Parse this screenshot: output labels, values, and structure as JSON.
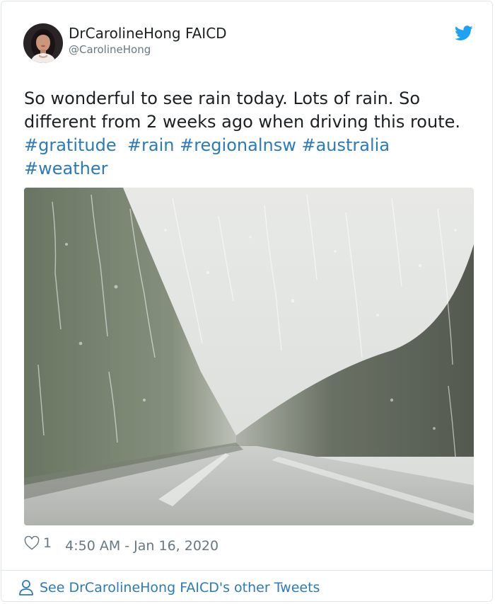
{
  "author": {
    "display_name": "DrCarolineHong FAICD",
    "handle": "@CarolineHong",
    "avatar_icon": "profile-photo"
  },
  "brand": {
    "icon": "twitter-bird-icon",
    "color": "#1da1f2"
  },
  "tweet": {
    "lines": [
      "So wonderful to see rain today. Lots of rain. So",
      "different from 2 weeks ago when driving this route."
    ],
    "hashtags": [
      "#gratitude",
      "#rain",
      "#regionalnsw",
      "#australia",
      "#weather"
    ],
    "link_color": "#2b7bb9"
  },
  "media": {
    "icon": "rainy-windshield-road-photo"
  },
  "meta": {
    "like_icon": "heart-icon",
    "like_count": "1",
    "timestamp": "4:50 AM - Jan 16, 2020"
  },
  "footer": {
    "icon": "person-icon",
    "label": "See DrCarolineHong FAICD's other Tweets"
  }
}
